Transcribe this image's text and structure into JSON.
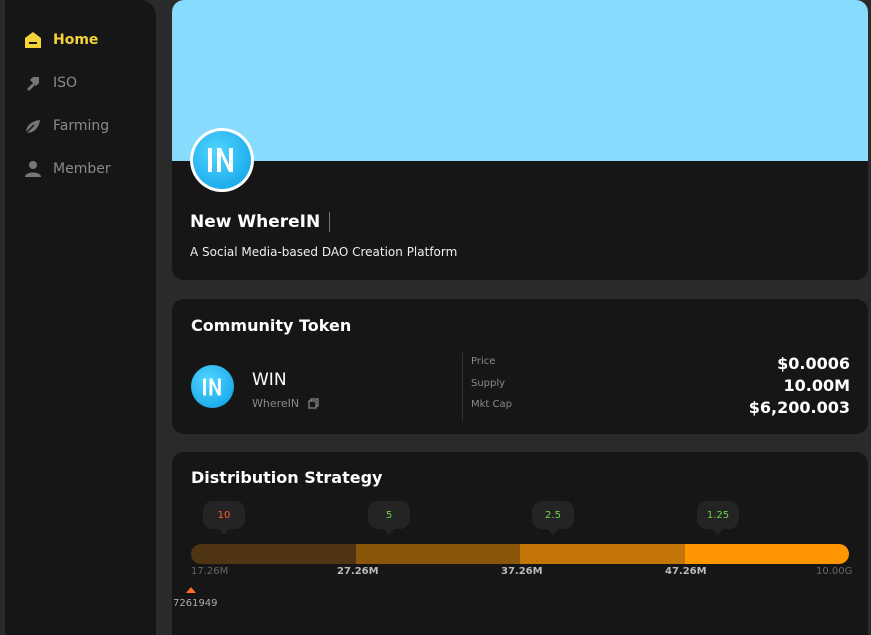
{
  "sidebar": {
    "items": [
      {
        "label": "Home",
        "icon": "home-icon",
        "active": true
      },
      {
        "label": "ISO",
        "icon": "shovel-icon",
        "active": false
      },
      {
        "label": "Farming",
        "icon": "sprout-icon",
        "active": false
      },
      {
        "label": "Member",
        "icon": "user-icon",
        "active": false
      }
    ]
  },
  "profile": {
    "name": "New WhereIN",
    "description": "A Social Media-based DAO Creation Platform",
    "banner_color": "#87dbfd"
  },
  "token": {
    "section_title": "Community Token",
    "symbol": "WIN",
    "name": "WhereIN",
    "stats": [
      {
        "label": "Price",
        "value": "$0.0006"
      },
      {
        "label": "Supply",
        "value": "10.00M"
      },
      {
        "label": "Mkt Cap",
        "value": "$6,200.003"
      }
    ]
  },
  "distribution": {
    "section_title": "Distribution Strategy",
    "bubbles": [
      {
        "value": "10",
        "color": "#ff5a2e"
      },
      {
        "value": "5",
        "color": "#6fd14a"
      },
      {
        "value": "2.5",
        "color": "#6fd14a"
      },
      {
        "value": "1.25",
        "color": "#6fd14a"
      }
    ],
    "segments": [
      {
        "color": "#4f3513",
        "share": 0.25
      },
      {
        "color": "#8a560c",
        "share": 0.25
      },
      {
        "color": "#c47508",
        "share": 0.25
      },
      {
        "color": "#ff9500",
        "share": 0.25
      }
    ],
    "ticks": [
      "17.26M",
      "27.26M",
      "37.26M",
      "47.26M",
      "10.00G"
    ],
    "current_value": "7261949"
  }
}
